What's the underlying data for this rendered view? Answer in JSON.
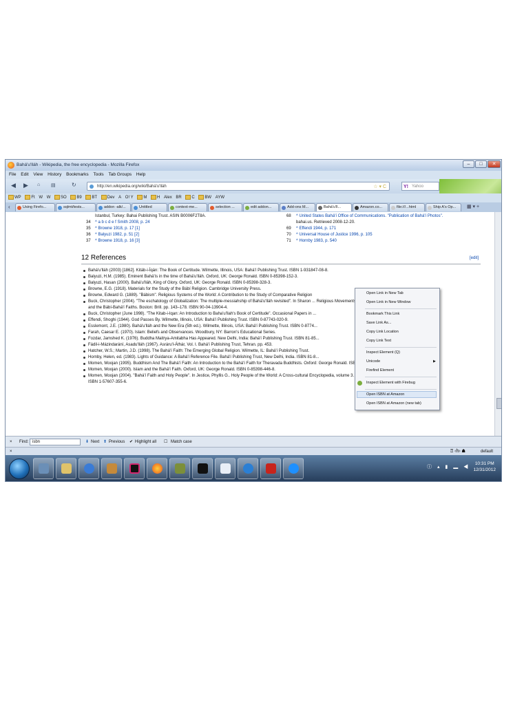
{
  "window": {
    "title": "Bahá'u'lláh - Wikipedia, the free encyclopedia - Mozilla Firefox"
  },
  "menu": [
    "File",
    "Edit",
    "View",
    "History",
    "Bookmarks",
    "Tools",
    "Tab Groups",
    "Help"
  ],
  "nav": {
    "url": "http://en.wikipedia.org/wiki/Bahá'u'lláh",
    "search_placeholder": "Yahoo"
  },
  "bookmarks": [
    "WP",
    "Ft",
    "W",
    "W",
    "SO",
    "B9",
    "BT",
    "Dev",
    "A",
    "O! Y",
    "M",
    "H",
    "Alex",
    "BR",
    "C",
    "BW",
    "AYW"
  ],
  "tabs": [
    "Using Firefo...",
    "sqlmt/tests...",
    "addon -alk/...",
    "Untitled",
    "context-me...",
    "selection ...",
    "edit addon...",
    "Add-ons M...",
    "Bahá'u'll...",
    "Amazon.co...",
    "file:///...html",
    "Ship A's Op..."
  ],
  "page": {
    "prev_notes": [
      {
        "text": "Istanbul, Turkey: Bahai Publishing Trust. ASIN B0006F2T8A."
      },
      {
        "num": "34",
        "text": "^ a b c d e f Smith 2008, p. 24"
      },
      {
        "num": "35",
        "text": "^ Browne 1918, p. 17 [1]"
      },
      {
        "num": "36",
        "text": "^ Balyuzi 1982, p. 51 [2]"
      },
      {
        "num": "37",
        "text": "^ Browne 1918, p. 16 [3]"
      }
    ],
    "prev_notes_right": [
      {
        "num": "68",
        "text": "^ United States Bahá'í Office of Communications. \"Publication of Bahá'í Photos\"."
      },
      {
        "num": "",
        "text": "bahai.us. Retrieved 2008-12-20."
      },
      {
        "num": "69",
        "text": "^ Effendi 1944, p. 171"
      },
      {
        "num": "70",
        "text": "^ Universal House of Justice 1996, p. 105"
      },
      {
        "num": "71",
        "text": "^ Hornby 1983, p. 540"
      }
    ],
    "section_title": "12 References",
    "edit_label": "[edit]",
    "references": [
      "Bahá'u'lláh (2003) [1862]. Kitáb-i-Íqán: The Book of Certitude. Wilmette, Illinois, USA: Bahá'í Publishing Trust. ISBN 1-931847-08-8.",
      "Balyuzi, H.M. (1985). Eminent Bahá'ís in the time of Bahá'u'lláh. Oxford, UK: George Ronald. ISBN 0-85398-152-3.",
      "Balyuzi, Hasan (2000). Bahá'u'lláh, King of Glory. Oxford, UK: George Ronald. ISBN 0-85398-328-3.",
      "Browne, E.G. (1918). Materials for the Study of the Bábí Religion. Cambridge University Press.",
      "Browne, Edward G. (1889). \"Bábism\". Religious Systems of the World: A Contribution to the Study of Comparative Religion",
      "Buck, Christopher (2004). \"The eschatology of Globalization: The multiple-messiahship of Bahá'u'lláh revisited\". In Sharon ... Religious Movements",
      "and the Bábí-Bahá'í Faiths. Boston: Brill. pp. 143–178. ISBN 90-04-13904-4.",
      "Buck, Christopher (June 1998). \"The Kitab-i-Iqan: An Introduction to Baha'u'llah's Book of Certitude\". Occasional Papers in ...",
      "Effendi, Shoghi (1944). God Passes By. Wilmette, Illinois, USA: Bahá'í Publishing Trust. ISBN 0-87743-020-9.",
      "Esslemont, J.E. (1980). Bahá'u'lláh and the New Era (5th ed.). Wilmette, Illinois, USA: Bahá'í Publishing Trust. ISBN 0-8774...",
      "Farah, Caesar E. (1970). Islam: Beliefs and Observances. Woodbury, NY: Barron's Educational Series.",
      "Fozdar, Jamshed K. (1976). Buddha Maitrya-Amitabha Has Appeared. New Delhi, India: Bahá'í Publishing Trust. ISBN 81-85...",
      "Fádil-i-Mázindarání, Asadu'lláh (1967). Asráru'l-Áthár, Vol. I. Bahá'í Publishing Trust, Tehran. pp. 453.",
      "Hatcher, W.S.; Martin, J.D. (1998). The Bahá'í Faith: The Emerging Global Religion. Wilmette, IL: Bahá'í Publishing Trust.",
      "Hornby, Helen, ed. (1983). Lights of Guidance: A Bahá'í Reference File. Bahá'í Publishing Trust, New Delhi, India. ISBN 81-8...",
      "Momen, Moojan (1995). Buddhism And The Bahá'í Faith: An Introduction to the Bahá'í Faith for Theravada Buddhists. Oxford: George Ronald. ISBN 0-85398-384-4.",
      "Momen, Moojan (2000). Islam and the Bahá'í Faith. Oxford, UK: George Ronald. ISBN 0-85398-446-8.",
      "Momen, Moojan (2004). \"Bahá'í Faith and Holy People\". In Jestice, Phyllis G.. Holy People of the World: A Cross-cultural Encyclopedia, volume 3. Santa Barbara, CA: ABC-CLIO.",
      "ISBN 1-57607-355-6."
    ]
  },
  "context_menu": [
    "Open Link in New Tab",
    "Open Link in New Window",
    "Bookmark This Link",
    "Save Link As...",
    "Copy Link Location",
    "Copy Link Text",
    "Inspect Element (Q)",
    "Unicode",
    "Firefind Element",
    "Inspect Element with Firebug",
    "Open ISBN at Amazon",
    "Open ISBN at Amazon (new tab)"
  ],
  "findbar": {
    "label": "Find:",
    "value": "isbn",
    "next": "Next",
    "previous": "Previous",
    "highlight": "Highlight all",
    "match_case": "Match case"
  },
  "statusbar": {
    "right": "default"
  },
  "taskbar": {
    "time": "10:31 PM",
    "date": "12/31/2012"
  },
  "colors": {
    "link": "#0645ad",
    "highlight": "#dde8f6",
    "taskbar": "#2c4566"
  }
}
